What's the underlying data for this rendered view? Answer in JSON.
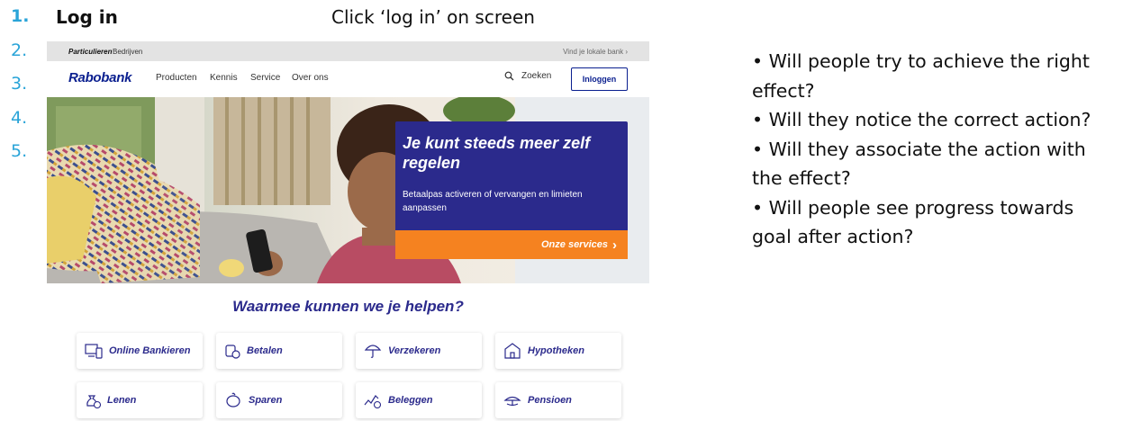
{
  "steps": {
    "numbers": [
      "1.",
      "2.",
      "3.",
      "4.",
      "5."
    ],
    "step1_title": "Log in",
    "instruction": "Click ‘log in’ on screen"
  },
  "bank": {
    "topbar": {
      "segments": [
        "Particulieren",
        "Bedrijven"
      ],
      "locate": "Vind je lokale bank ›"
    },
    "logo": "Rabobank",
    "nav": [
      "Producten",
      "Kennis",
      "Service",
      "Over ons"
    ],
    "search_label": "Zoeken",
    "login_label": "Inloggen",
    "hero": {
      "title": "Je kunt steeds meer zelf regelen",
      "subtitle": "Betaalpas activeren of vervangen en limieten aanpassen",
      "cta": "Onze services",
      "cta_arrow": "›"
    },
    "help_title": "Waarmee kunnen we je helpen?",
    "tiles": [
      {
        "label": "Online Bankieren",
        "icon": "online-banking-icon"
      },
      {
        "label": "Betalen",
        "icon": "payment-icon"
      },
      {
        "label": "Verzekeren",
        "icon": "umbrella-icon"
      },
      {
        "label": "Hypotheken",
        "icon": "house-icon"
      },
      {
        "label": "Lenen",
        "icon": "money-bag-icon"
      },
      {
        "label": "Sparen",
        "icon": "piggy-bank-icon"
      },
      {
        "label": "Beleggen",
        "icon": "investment-icon"
      },
      {
        "label": "Pensioen",
        "icon": "pension-icon"
      }
    ],
    "colors": {
      "brand_blue": "#0a1f8f",
      "panel_blue": "#2b2a8c",
      "cta_orange": "#f58220",
      "step_blue": "#2aa4d8"
    }
  },
  "questions": [
    "• Will people try to achieve the right effect?",
    "• Will they notice the correct action?",
    "• Will they associate the action with the effect?",
    "• Will people see progress towards goal after action?"
  ]
}
